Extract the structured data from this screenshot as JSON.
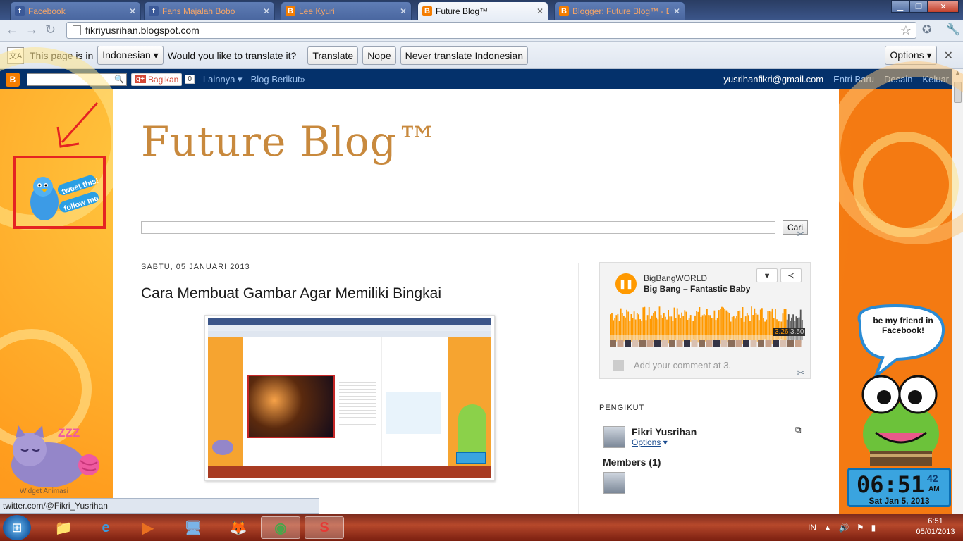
{
  "browser": {
    "tabs": [
      {
        "title": "Facebook",
        "active": false,
        "fav_color": "#3b5998",
        "fav_glyph": "f"
      },
      {
        "title": "Fans Majalah Bobo",
        "active": false,
        "fav_color": "#3b5998",
        "fav_glyph": "f"
      },
      {
        "title": "Lee Kyuri",
        "active": false,
        "fav_color": "#f57d00",
        "fav_glyph": "B"
      },
      {
        "title": "Future Blog™",
        "active": true,
        "fav_color": "#f57d00",
        "fav_glyph": "B"
      },
      {
        "title": "Blogger: Future Blog™ - D",
        "active": false,
        "fav_color": "#f57d00",
        "fav_glyph": "B"
      }
    ],
    "url": "fikriyusrihan.blogspot.com",
    "window_controls": {
      "minimize": "▁",
      "maximize": "❐",
      "close": "✕"
    }
  },
  "translate_bar": {
    "prompt": "This page is in",
    "language": "Indonesian",
    "question": "Would you like to translate it?",
    "translate_label": "Translate",
    "nope_label": "Nope",
    "never_label": "Never translate Indonesian",
    "options_label": "Options"
  },
  "blogger_navbar": {
    "share_label": "Bagikan",
    "share_count": "0",
    "more_label": "Lainnya ▾",
    "next_blog_label": "Blog Berikut»",
    "email": "yusrihanfikri@gmail.com",
    "new_post_label": "Entri Baru",
    "design_label": "Desain",
    "logout_label": "Keluar"
  },
  "blog": {
    "title": "Future Blog™",
    "search_button": "Cari",
    "date_header": "SABTU, 05 JANUARI 2013",
    "post_title": "Cara Membuat Gambar Agar Memiliki Bingkai"
  },
  "left_widgets": {
    "tweet_text_1": "tweet this!",
    "tweet_text_2": "follow me",
    "cat_label": "Widget Animasi",
    "zzz": "ZZZ"
  },
  "player": {
    "artist": "BigBangWORLD",
    "track": "Big Bang – Fantastic Baby",
    "time_current": "3.26",
    "time_total": "3.50",
    "comment_placeholder": "Add your comment at 3.",
    "progress": 0.91
  },
  "followers": {
    "heading": "PENGIKUT",
    "name": "Fikri Yusrihan",
    "options_label": "Options",
    "members_label": "Members (1)"
  },
  "right_widgets": {
    "bubble_text": "be my friend in Facebook!",
    "clock_time": "06:51",
    "clock_seconds": "42",
    "clock_ampm": "AM",
    "clock_date": "Sat Jan 5, 2013"
  },
  "status_bar": {
    "text": "twitter.com/@Fikri_Yusrihan"
  },
  "taskbar": {
    "items": [
      {
        "name": "explorer",
        "glyph": "📁",
        "active": false
      },
      {
        "name": "internet-explorer",
        "glyph": "e",
        "active": false
      },
      {
        "name": "media-player",
        "glyph": "▶",
        "active": false
      },
      {
        "name": "network-app",
        "glyph": "🖥",
        "active": false
      },
      {
        "name": "firefox",
        "glyph": "🦊",
        "active": false
      },
      {
        "name": "chrome",
        "glyph": "◉",
        "active": true
      },
      {
        "name": "corel",
        "glyph": "S",
        "active": true
      }
    ],
    "lang": "IN",
    "time": "6:51",
    "date": "05/01/2013"
  }
}
